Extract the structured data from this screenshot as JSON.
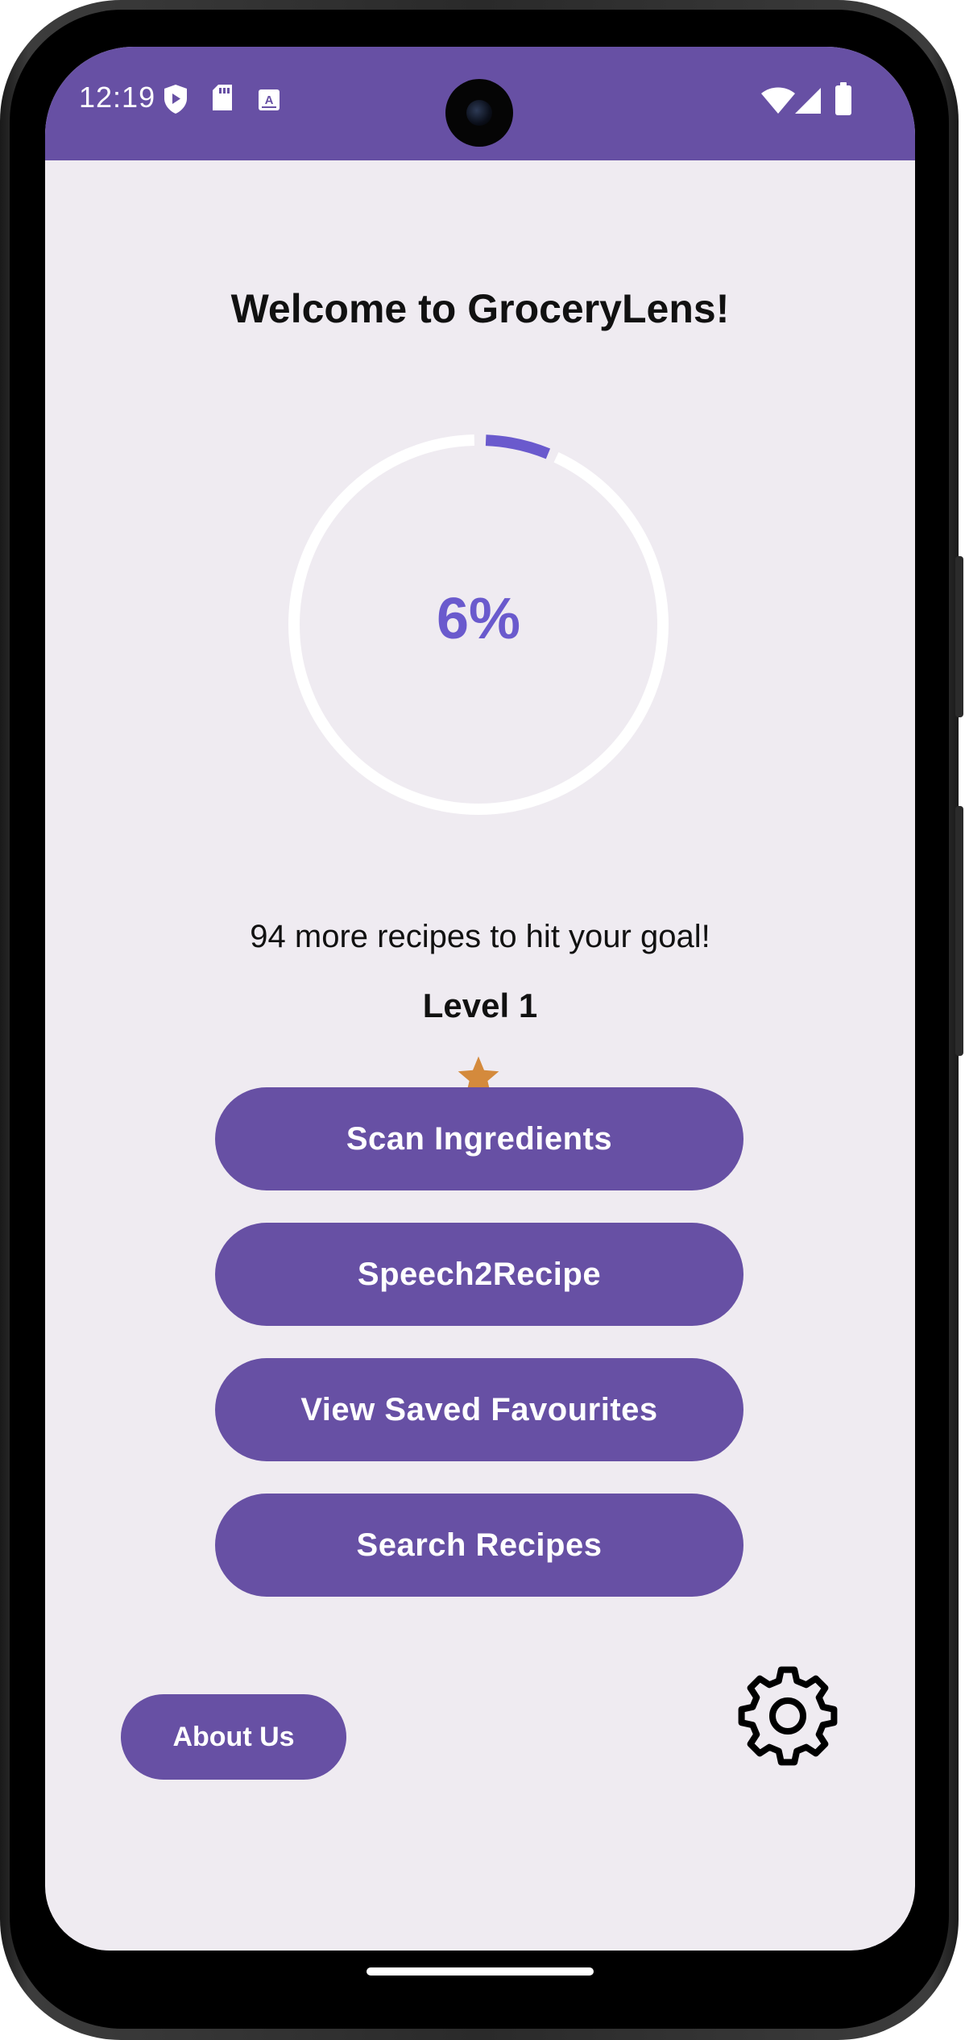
{
  "status_bar": {
    "time": "12:19",
    "bg_color": "#6750a4",
    "left_icons": [
      "play-protect-icon",
      "sd-card-icon",
      "keyboard-a-icon"
    ],
    "right_icons": [
      "wifi-icon",
      "cell-signal-icon",
      "battery-icon"
    ]
  },
  "main": {
    "title": "Welcome to GroceryLens!",
    "progress": {
      "percent_label": "6%",
      "value": 0.06,
      "arc_color": "#6a5acd",
      "track_color": "#ffffff"
    },
    "goal_text": "94 more recipes to hit your goal!",
    "level_text": "Level 1",
    "star_icon": "star-icon",
    "star_color": "#d48a3c",
    "buttons": [
      {
        "label": "Scan Ingredients"
      },
      {
        "label": "Speech2Recipe"
      },
      {
        "label": "View Saved Favourites"
      },
      {
        "label": "Search Recipes"
      }
    ],
    "about_button": {
      "label": "About Us"
    },
    "settings_icon": "gear-icon"
  },
  "colors": {
    "accent": "#6750a4",
    "background": "#efebf1"
  }
}
